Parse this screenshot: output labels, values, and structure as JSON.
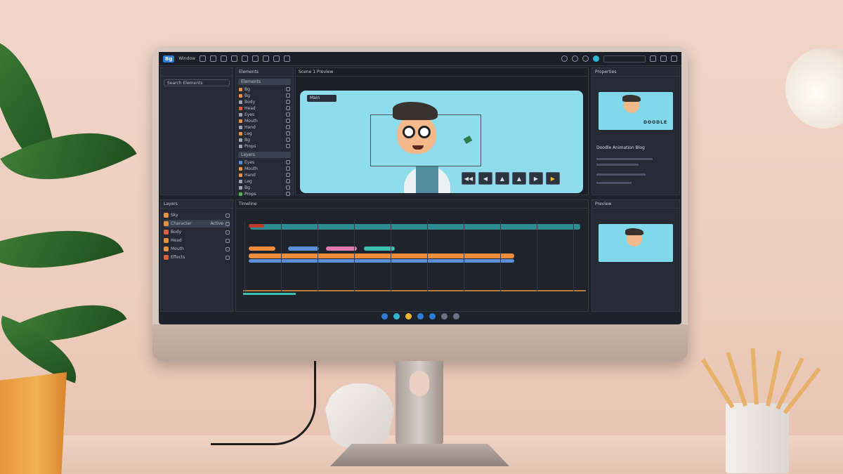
{
  "app": {
    "logo_text": "Bg"
  },
  "titlebar": {
    "menu_label": "Window"
  },
  "left_panel": {
    "search_placeholder": "Search Elements"
  },
  "assets_panel": {
    "title": "Elements",
    "group1_label": "Elements",
    "group2_label": "Layers",
    "items": [
      "Bg",
      "Bg",
      "Body",
      "Head",
      "Eyes",
      "Mouth",
      "Hand",
      "Leg",
      "Bg",
      "Props"
    ],
    "colors": [
      "#e8913a",
      "#e8913a",
      "#9aa3b3",
      "#e05d3a",
      "#9aa3b3",
      "#e8913a",
      "#9aa3b3",
      "#e8913a",
      "#9aa3b3",
      "#9aa3b3",
      "#4f8fdc",
      "#e8913a",
      "#e8913a",
      "#9aa3b3",
      "#9aa3b3",
      "#55b05a"
    ]
  },
  "preview": {
    "header": "Scene 1 Preview",
    "badge_label": "Main",
    "controls": [
      "◀◀",
      "◀",
      "▲",
      "▲",
      "▶",
      "▶"
    ],
    "accent": "#f2b632"
  },
  "right_panel": {
    "title": "Properties",
    "card_title": "Doodle Animation Blog",
    "thumb_caption": "DOODLE",
    "lower_title": "Preview"
  },
  "layers_panel": {
    "title": "Layers",
    "items": [
      "Sky",
      "Character",
      "Body",
      "Head",
      "Mouth",
      "Effects"
    ],
    "colors": [
      "#e8913a",
      "#e8913a",
      "#e05d3a",
      "#e8913a",
      "#e8913a",
      "#e05d3a"
    ],
    "tag": "Active"
  },
  "timeline": {
    "title": "Timeline",
    "colors": {
      "track": "#2e8b8f",
      "orange": "#f08a3c",
      "blue": "#5a8fd8",
      "pink": "#e07ab0",
      "teal": "#3dbfae"
    }
  }
}
